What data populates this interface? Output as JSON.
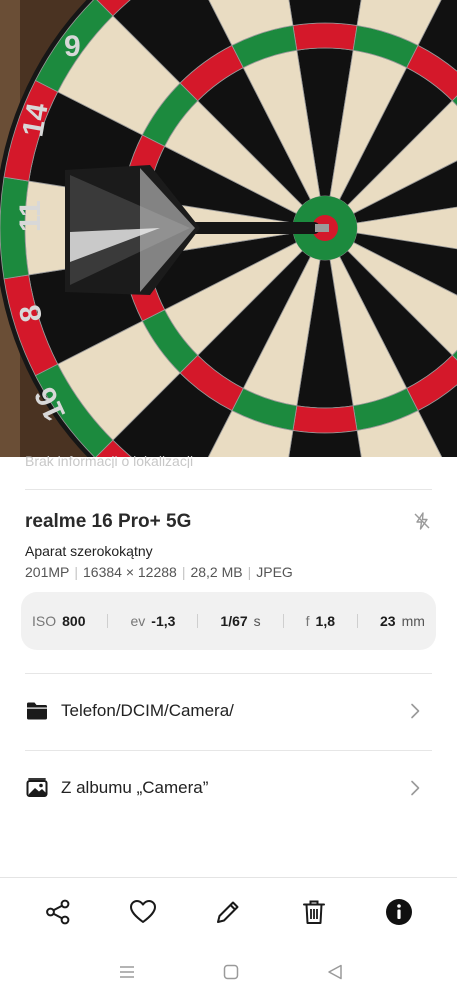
{
  "photo": {
    "subject": "dartboard-with-dart"
  },
  "details": {
    "location": "Brak informacji o lokalizacji",
    "device_name": "realme 16 Pro+ 5G",
    "camera_name": "Aparat szerokokątny",
    "megapixels": "201MP",
    "resolution": "16384 × 12288",
    "file_size": "28,2 MB",
    "format": "JPEG"
  },
  "exif": {
    "iso_label": "ISO",
    "iso_value": "800",
    "ev_label": "ev",
    "ev_value": "-1,3",
    "shutter_value": "1/67",
    "shutter_unit": "s",
    "aperture_label": "f",
    "aperture_value": "1,8",
    "focal_value": "23",
    "focal_unit": "mm"
  },
  "rows": {
    "path": "Telefon/DCIM/Camera/",
    "album": "Z albumu „Camera”"
  },
  "icons": {
    "flash": "flash-off-icon",
    "folder": "folder-icon",
    "album": "album-icon",
    "chevron": "chevron-right-icon",
    "share": "share-icon",
    "favorite": "heart-icon",
    "edit": "pencil-icon",
    "delete": "trash-icon",
    "info": "info-icon"
  }
}
